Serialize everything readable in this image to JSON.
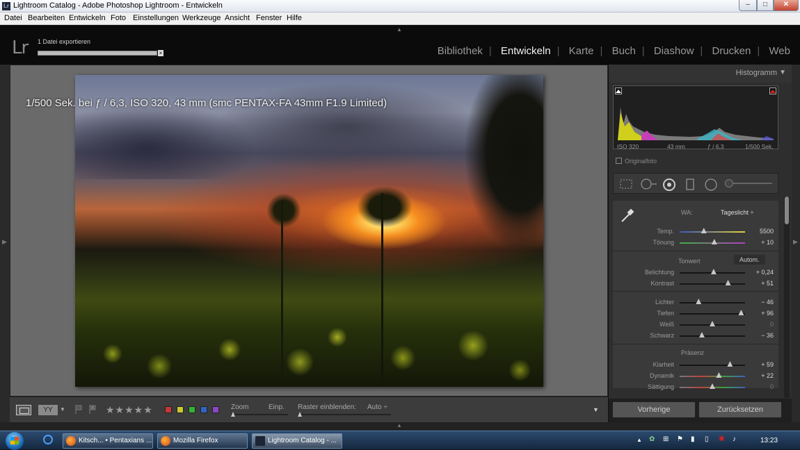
{
  "window": {
    "title": "Lightroom Catalog - Adobe Photoshop Lightroom - Entwickeln",
    "app_icon": "Lr",
    "min": "–",
    "max": "□",
    "close": "✕"
  },
  "menu": [
    "Datei",
    "Bearbeiten",
    "Entwickeln",
    "Foto",
    "Einstellungen",
    "Werkzeuge",
    "Ansicht",
    "Fenster",
    "Hilfe"
  ],
  "lr": {
    "logo": "Lr",
    "export_label": "1 Datei exportieren",
    "export_progress": 1.0,
    "cancel": "×"
  },
  "modules": [
    "Bibliothek",
    "Entwickeln",
    "Karte",
    "Buch",
    "Diashow",
    "Drucken",
    "Web"
  ],
  "active_module": "Entwickeln",
  "photo": {
    "exif_overlay": "1/500 Sek. bei ƒ / 6,3, ISO 320, 43 mm (smc PENTAX-FA 43mm F1.9 Limited)"
  },
  "toolbar": {
    "view_yy": "YY",
    "stars": "★★★★★",
    "color_labels": [
      "#c83737",
      "#c8c832",
      "#32b432",
      "#3264c8",
      "#8c46c8"
    ],
    "zoom_label": "Zoom",
    "zoom_value": "Einp.",
    "raster_label": "Raster einblenden:",
    "raster_value": "Auto ÷",
    "more": "▼"
  },
  "histogram": {
    "title": "Histogramm",
    "iso": "ISO 320",
    "focal": "43 mm",
    "aperture": "ƒ / 6,3",
    "shutter": "1/500 Sek.",
    "original_label": "Originalfoto"
  },
  "basic": {
    "wb_label": "WA:",
    "wb_value": "Tageslicht ÷",
    "tone_label": "Tonwert",
    "auto_label": "Autom.",
    "presence_label": "Präsenz",
    "rows": [
      {
        "label": "Temp.",
        "value": "5500",
        "pos": 0.37
      },
      {
        "label": "Tönung",
        "value": "+ 10",
        "pos": 0.53
      },
      {
        "label": "Belichtung",
        "value": "+ 0,24",
        "pos": 0.52
      },
      {
        "label": "Kontrast",
        "value": "+ 51",
        "pos": 0.74
      },
      {
        "label": "Lichter",
        "value": "− 46",
        "pos": 0.29
      },
      {
        "label": "Tiefen",
        "value": "+ 96",
        "pos": 0.94
      },
      {
        "label": "Weiß",
        "value": "0",
        "pos": 0.5
      },
      {
        "label": "Schwarz",
        "value": "− 36",
        "pos": 0.34
      },
      {
        "label": "Klarheit",
        "value": "+ 59",
        "pos": 0.77
      },
      {
        "label": "Dynamik",
        "value": "+ 22",
        "pos": 0.6
      },
      {
        "label": "Sättigung",
        "value": "0",
        "pos": 0.5
      }
    ]
  },
  "buttons": {
    "previous": "Vorherige",
    "reset": "Zurücksetzen"
  },
  "taskbar": {
    "tasks": [
      "Kitsch... • Pentaxians ...",
      "Mozilla Firefox",
      "Lightroom Catalog - ..."
    ],
    "clock": "13:23"
  }
}
